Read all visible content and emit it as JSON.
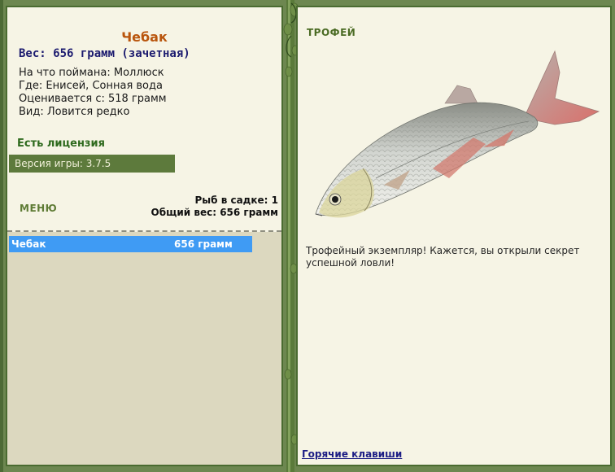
{
  "left": {
    "fish_name": "Чебак",
    "weight_line": "Вес: 656 грамм (зачетная)",
    "info": [
      "На что поймана: Моллюск",
      "Где: Енисей, Сонная вода",
      "Оценивается с: 518 грамм",
      "Вид: Ловится редко"
    ],
    "license": "Есть лицензия",
    "version": "Версия игры: 3.7.5",
    "menu_label": "МЕНЮ",
    "stats": {
      "count": "Рыб в садке: 1",
      "total": "Общий вес: 656 грамм"
    },
    "catch_list": [
      {
        "name": "Чебак",
        "weight": "656 грамм"
      }
    ]
  },
  "right": {
    "title": "ТРОФЕЙ",
    "fish_image": "chebak-fish-illustration",
    "text": "Трофейный экземпляр! Кажется, вы открыли секрет успешной ловли!",
    "hotkeys": "Горячие клавиши"
  },
  "colors": {
    "frame": "#6d8750",
    "panel": "#f6f4e5",
    "fish_name": "#b9550d",
    "weight": "#1c1b6f",
    "selected_row": "#3f9bf4",
    "version_bar": "#5d7a3c"
  }
}
